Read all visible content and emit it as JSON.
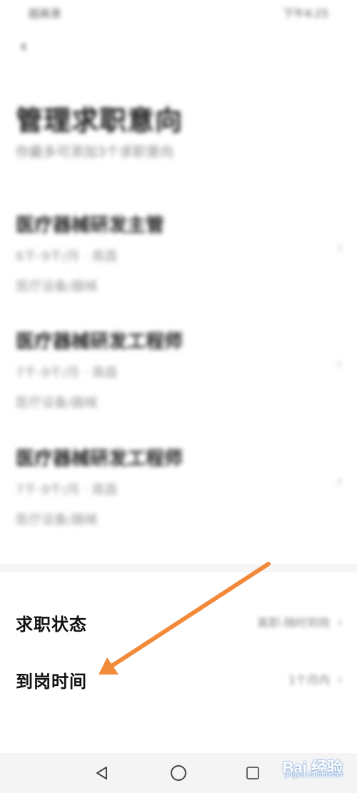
{
  "status_bar": {
    "left": "超高清",
    "right": "下午4:25"
  },
  "header": {
    "title": "管理求职意向",
    "subtitle": "你最多可添加3个求职意向"
  },
  "intentions": [
    {
      "title": "医疗器械研发主管",
      "line1": "6千-9千/月 · 南昌",
      "line2": "医疗设备/器械"
    },
    {
      "title": "医疗器械研发工程师",
      "line1": "7千-9千/月 · 南昌",
      "line2": "医疗设备/器械"
    },
    {
      "title": "医疗器械研发工程师",
      "line1": "7千-9千/月 · 南昌",
      "line2": "医疗设备/器械"
    }
  ],
  "settings": {
    "status_label": "求职状态",
    "status_value": "离职-随时到岗",
    "arrival_label": "到岗时间",
    "arrival_value": "1个月内"
  },
  "watermark": {
    "brand": "Bai 经验",
    "domain": "jingyan.baidu.com"
  },
  "colors": {
    "arrow": "#f28a3a",
    "nav_background": "#f4f4f4"
  },
  "icons": {
    "back": "chevron-left-icon",
    "nav": [
      "triangle-back-icon",
      "circle-home-icon",
      "square-recents-icon"
    ]
  }
}
